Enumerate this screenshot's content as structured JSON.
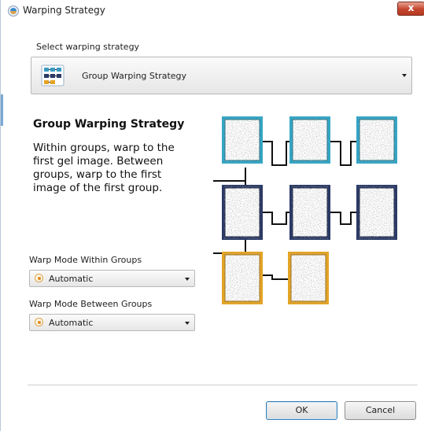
{
  "window": {
    "title": "Warping Strategy",
    "close_glyph": "x"
  },
  "strategy": {
    "label": "Select warping strategy",
    "selected": "Group Warping Strategy",
    "icon": "group-strategy-icon"
  },
  "description": {
    "heading": "Group Warping Strategy",
    "body": "Within groups, warp to the first gel image. Between groups, warp to the first image of the first group."
  },
  "within_groups": {
    "label": "Warp Mode Within Groups",
    "selected": "Automatic"
  },
  "between_groups": {
    "label": "Warp Mode Between Groups",
    "selected": "Automatic"
  },
  "diagram": {
    "frame_colors": [
      "#35a6c4",
      "#2b3a66",
      "#e3a425"
    ],
    "rows": [
      3,
      3,
      2
    ]
  },
  "buttons": {
    "ok": "OK",
    "cancel": "Cancel"
  }
}
